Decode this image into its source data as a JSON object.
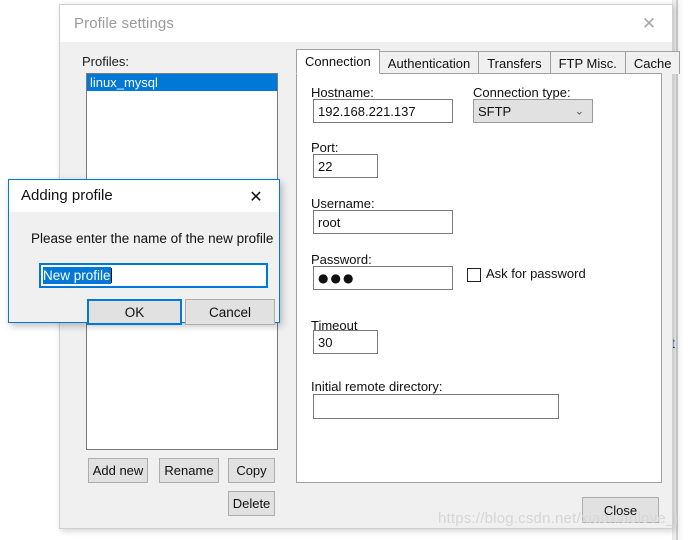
{
  "window": {
    "title": "Profile settings",
    "close_icon": "close-icon"
  },
  "left_panel": {
    "profiles_label": "Profiles:",
    "profiles": [
      {
        "name": "linux_mysql",
        "selected": true
      }
    ],
    "buttons": {
      "add_new": "Add new",
      "rename": "Rename",
      "copy": "Copy",
      "delete": "Delete"
    }
  },
  "tabs": [
    {
      "label": "Connection",
      "active": true
    },
    {
      "label": "Authentication",
      "active": false
    },
    {
      "label": "Transfers",
      "active": false
    },
    {
      "label": "FTP Misc.",
      "active": false
    },
    {
      "label": "Cache",
      "active": false
    }
  ],
  "connection_tab": {
    "hostname_label": "Hostname:",
    "hostname_value": "192.168.221.137",
    "connection_type_label": "Connection type:",
    "connection_type_value": "SFTP",
    "connection_type_options": [
      "SFTP"
    ],
    "port_label": "Port:",
    "port_value": "22",
    "username_label": "Username:",
    "username_value": "root",
    "password_label": "Password:",
    "password_value": "●●●",
    "ask_for_password_label": "Ask for password",
    "ask_for_password_checked": false,
    "timeout_label": "Timeout",
    "timeout_value": "30",
    "initial_remote_directory_label": "Initial remote directory:",
    "initial_remote_directory_value": ""
  },
  "footer": {
    "close_button": "Close"
  },
  "adding_profile_dialog": {
    "title": "Adding profile",
    "close_icon": "close-icon",
    "message": "Please enter the name of the new profile",
    "input_value": "New profile",
    "ok_label": "OK",
    "cancel_label": "Cancel"
  },
  "background": {
    "remnant_text": "ct"
  },
  "watermark": {
    "text": "https://blog.csdn.net/xiaoxiaolove_j"
  },
  "colors": {
    "accent": "#0078d7",
    "window_bg": "#f0f0f0",
    "panel_bg": "#ffffff",
    "button_bg": "#e1e1e1"
  }
}
